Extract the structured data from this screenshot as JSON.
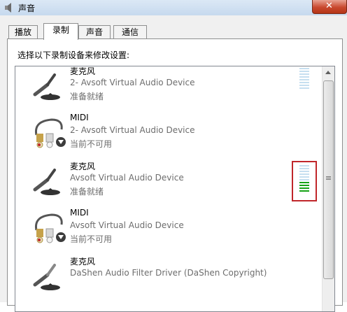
{
  "window": {
    "title": "声音",
    "close_label": "✕"
  },
  "tabs": [
    {
      "label": "播放",
      "active": false
    },
    {
      "label": "录制",
      "active": true
    },
    {
      "label": "声音",
      "active": false
    },
    {
      "label": "通信",
      "active": false
    }
  ],
  "instruction": "选择以下录制设备来修改设置:",
  "devices": [
    {
      "name": "麦克风",
      "description": "2- Avsoft Virtual Audio Device",
      "status": "准备就绪",
      "icon": "microphone-icon",
      "level_bars_lit": 0
    },
    {
      "name": "MIDI",
      "description": "2- Avsoft Virtual Audio Device",
      "status": "当前不可用",
      "icon": "audio-cable-icon",
      "status_icon": "unavailable-arrow-icon"
    },
    {
      "name": "麦克风",
      "description": "Avsoft Virtual Audio Device",
      "status": "准备就绪",
      "icon": "microphone-icon",
      "level_bars_lit": 4
    },
    {
      "name": "MIDI",
      "description": "Avsoft Virtual Audio Device",
      "status": "当前不可用",
      "icon": "audio-cable-icon",
      "status_icon": "unavailable-arrow-icon"
    },
    {
      "name": "麦克风",
      "description": "DaShen Audio Filter Driver (DaShen Copyright)",
      "status": "",
      "icon": "microphone-icon"
    }
  ],
  "colors": {
    "highlight": "#c0262a",
    "meter_on": "#17a317",
    "meter_off": "#c6dff0"
  }
}
